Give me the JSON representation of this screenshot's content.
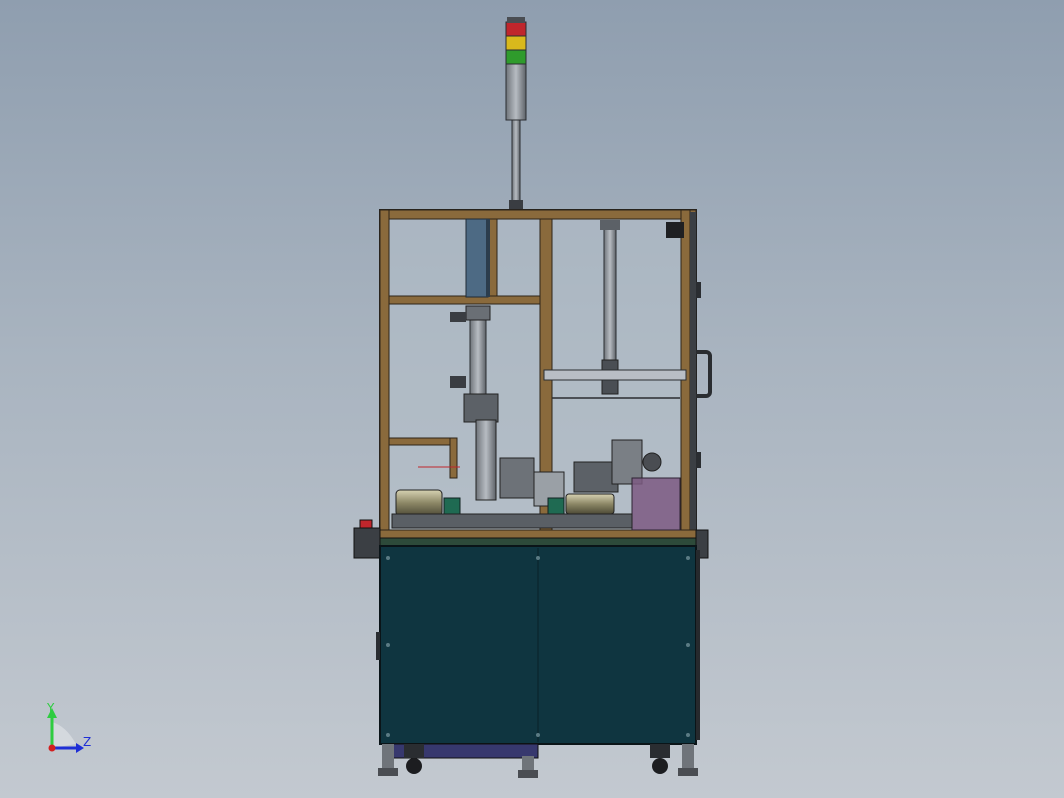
{
  "viewport": {
    "background_top": "#8f9eaf",
    "background_bottom": "#c3c9d0"
  },
  "model": {
    "frame_color": "#8a6a3c",
    "cabinet_color": "#0f3540",
    "stack_light_colors": [
      "#c0262c",
      "#d9b91c",
      "#2f9b2c"
    ]
  },
  "triad": {
    "y_label": "Y",
    "z_label": "Z",
    "y_color": "#2ecc40",
    "z_color": "#1f2fd6",
    "origin_color": "#d21f1f"
  }
}
